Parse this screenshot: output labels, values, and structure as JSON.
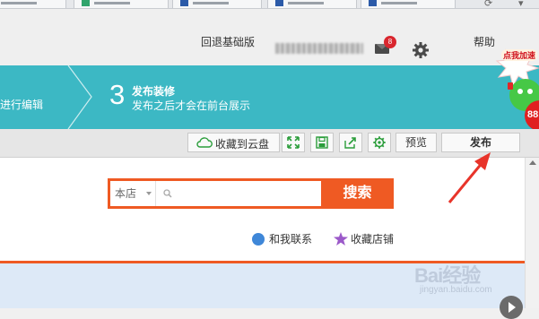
{
  "header": {
    "classic_link": "回退基础版",
    "mail_badge_count": "8",
    "help_link": "帮助"
  },
  "steps": {
    "prev_step_text": "进行编辑",
    "current_number": "3",
    "current_title": "发布装修",
    "current_subtitle": "发布之后才会在前台展示"
  },
  "toolbar": {
    "save_to_cloud": "收藏到云盘",
    "preview": "预览",
    "publish": "发布"
  },
  "search": {
    "scope": "本店",
    "placeholder": "",
    "button": "搜索"
  },
  "shop_links": {
    "contact": "和我联系",
    "favorite": "收藏店铺"
  },
  "accelerate": {
    "label": "点我加速",
    "value": "88"
  },
  "watermark": {
    "brand": "Bai经验",
    "url": "jingyan.baidu.com"
  },
  "colors": {
    "teal_band": "#3cb8c4",
    "search_orange": "#ef5a23",
    "toolbar_green_icons": "#2a9d3a"
  }
}
